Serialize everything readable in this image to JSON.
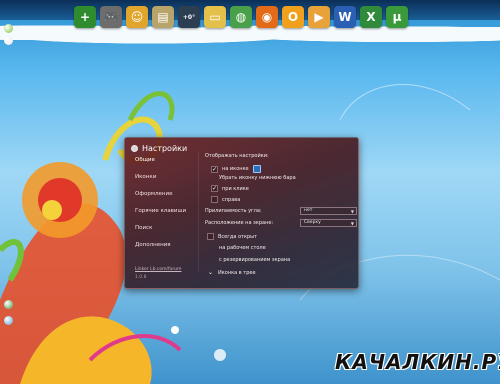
{
  "dock": {
    "items": [
      {
        "icon": "add-icon",
        "label": "+",
        "color": "#2e8b2e"
      },
      {
        "icon": "gamepad-icon",
        "label": "🎮",
        "color": "#6d6d6d"
      },
      {
        "icon": "messenger-icon",
        "label": "☺",
        "color": "#e0a52a"
      },
      {
        "icon": "clipboard-icon",
        "label": "▤",
        "color": "#b8a36a"
      },
      {
        "icon": "weather-icon",
        "label": "+0°",
        "color": "#2c3e52"
      },
      {
        "icon": "folder-icon",
        "label": "▭",
        "color": "#e2c04a"
      },
      {
        "icon": "chrome-icon",
        "label": "◍",
        "color": "#4aa04a"
      },
      {
        "icon": "firefox-icon",
        "label": "◉",
        "color": "#e36a18"
      },
      {
        "icon": "outlook-icon",
        "label": "O",
        "color": "#f0a01c"
      },
      {
        "icon": "media-player-icon",
        "label": "▶",
        "color": "#e8a23a"
      },
      {
        "icon": "word-icon",
        "label": "W",
        "color": "#2a5fb4"
      },
      {
        "icon": "excel-icon",
        "label": "X",
        "color": "#2f8a3a"
      },
      {
        "icon": "utorrent-icon",
        "label": "µ",
        "color": "#3a9a3a"
      }
    ]
  },
  "window": {
    "title": "Настройки",
    "nav": [
      "Общие",
      "Иконки",
      "Оформление",
      "Горячие клавиши",
      "Поиск",
      "Дополнения"
    ],
    "footer_link": "Linker Lb.com/forum",
    "footer_version": "1.0.8",
    "content": {
      "header": "Отображать настройки:",
      "opt1": "на иконке",
      "opt2": "Убрать иконку нижнюю бара",
      "opt3": "при клике",
      "opt4": "справа",
      "label_anchor": "Прилипаемость угла:",
      "select_anchor": "нет",
      "label_pos": "Расположение на экране:",
      "select_pos": "Сверху",
      "opt5": "Всегда открыт",
      "opt6": "на рабочем столе",
      "opt7": "с резервированием экрана",
      "opt8": "Иконка в трее"
    }
  },
  "watermark": "КАЧАЛКИН.РУ"
}
